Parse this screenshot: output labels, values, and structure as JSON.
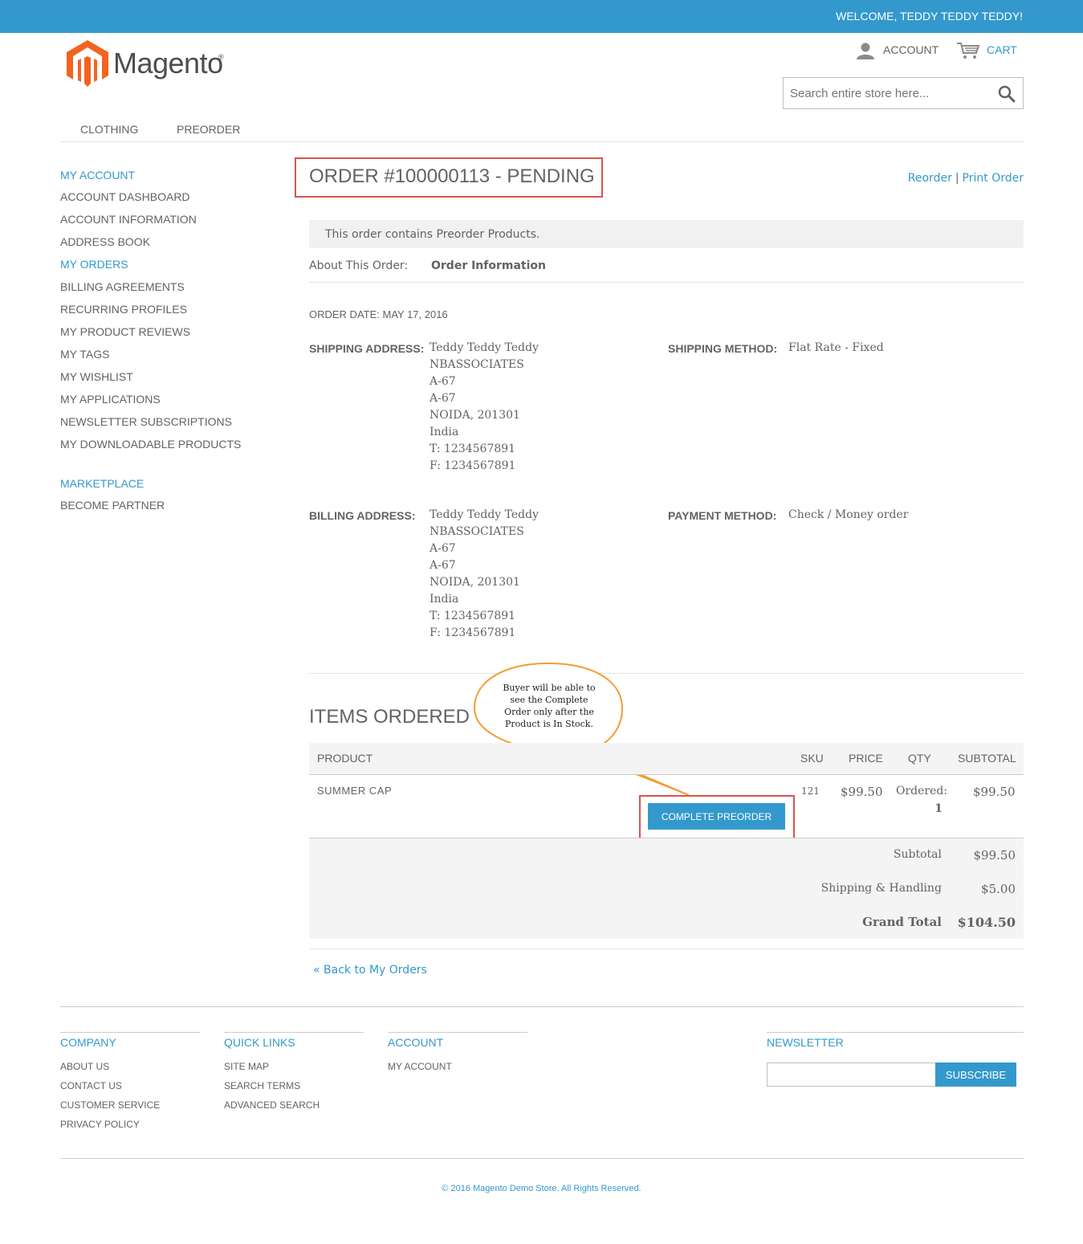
{
  "header": {
    "welcome": "WELCOME, TEDDY TEDDY TEDDY!",
    "logo_text": "Magento",
    "account_label": "ACCOUNT",
    "cart_label": "CART",
    "search_placeholder": "Search entire store here..."
  },
  "nav": [
    "CLOTHING",
    "PREORDER"
  ],
  "sidebar": {
    "account_title": "MY ACCOUNT",
    "items": [
      "ACCOUNT DASHBOARD",
      "ACCOUNT INFORMATION",
      "ADDRESS BOOK",
      "MY ORDERS",
      "BILLING AGREEMENTS",
      "RECURRING PROFILES",
      "MY PRODUCT REVIEWS",
      "MY TAGS",
      "MY WISHLIST",
      "MY APPLICATIONS",
      "NEWSLETTER SUBSCRIPTIONS",
      "MY DOWNLOADABLE PRODUCTS"
    ],
    "marketplace_title": "MARKETPLACE",
    "marketplace_items": [
      "BECOME PARTNER"
    ]
  },
  "order": {
    "title": "ORDER #100000113 - PENDING",
    "reorder": "Reorder",
    "separator": "|",
    "print": "Print Order",
    "notice": "This order contains Preorder Products.",
    "about_label": "About This Order:",
    "about_value": "Order Information",
    "date": "ORDER DATE: MAY 17, 2016",
    "shipping_address_label": "SHIPPING ADDRESS:",
    "shipping_address": [
      "Teddy Teddy Teddy",
      "NBASSOCIATES",
      "A-67",
      "A-67",
      "NOIDA, 201301",
      "India",
      "T: 1234567891",
      "F: 1234567891"
    ],
    "shipping_method_label": "SHIPPING METHOD:",
    "shipping_method": "Flat Rate - Fixed",
    "billing_address_label": "BILLING ADDRESS:",
    "billing_address": [
      "Teddy Teddy Teddy",
      "NBASSOCIATES",
      "A-67",
      "A-67",
      "NOIDA, 201301",
      "India",
      "T: 1234567891",
      "F: 1234567891"
    ],
    "payment_method_label": "PAYMENT METHOD:",
    "payment_method": "Check / Money order"
  },
  "items": {
    "title": "ITEMS ORDERED",
    "columns": [
      "PRODUCT",
      "SKU",
      "PRICE",
      "QTY",
      "SUBTOTAL"
    ],
    "row": {
      "product": "SUMMER CAP",
      "sku": "121",
      "price": "$99.50",
      "qty_label": "Ordered:",
      "qty_value": "1",
      "subtotal": "$99.50"
    },
    "preorder_button": "COMPLETE PREORDER",
    "callout": "Buyer will be able to see the Complete Order only after the Product is In Stock."
  },
  "totals": {
    "subtotal_label": "Subtotal",
    "subtotal": "$99.50",
    "shipping_label": "Shipping & Handling",
    "shipping": "$5.00",
    "grand_label": "Grand Total",
    "grand": "$104.50"
  },
  "back_link": "« Back to My Orders",
  "footer": {
    "company_title": "COMPANY",
    "company_links": [
      "ABOUT US",
      "CONTACT US",
      "CUSTOMER SERVICE",
      "PRIVACY POLICY"
    ],
    "quick_title": "QUICK LINKS",
    "quick_links": [
      "SITE MAP",
      "SEARCH TERMS",
      "ADVANCED SEARCH"
    ],
    "account_title": "ACCOUNT",
    "account_links": [
      "MY ACCOUNT"
    ],
    "newsletter_title": "NEWSLETTER",
    "subscribe": "SUBSCRIBE",
    "copyright": "© 2016 Magento Demo Store. All Rights Reserved."
  },
  "colors": {
    "brand_blue": "#3399cc",
    "highlight_red": "#d9534f",
    "logo_orange": "#f26322",
    "callout_orange": "#f39c33"
  }
}
